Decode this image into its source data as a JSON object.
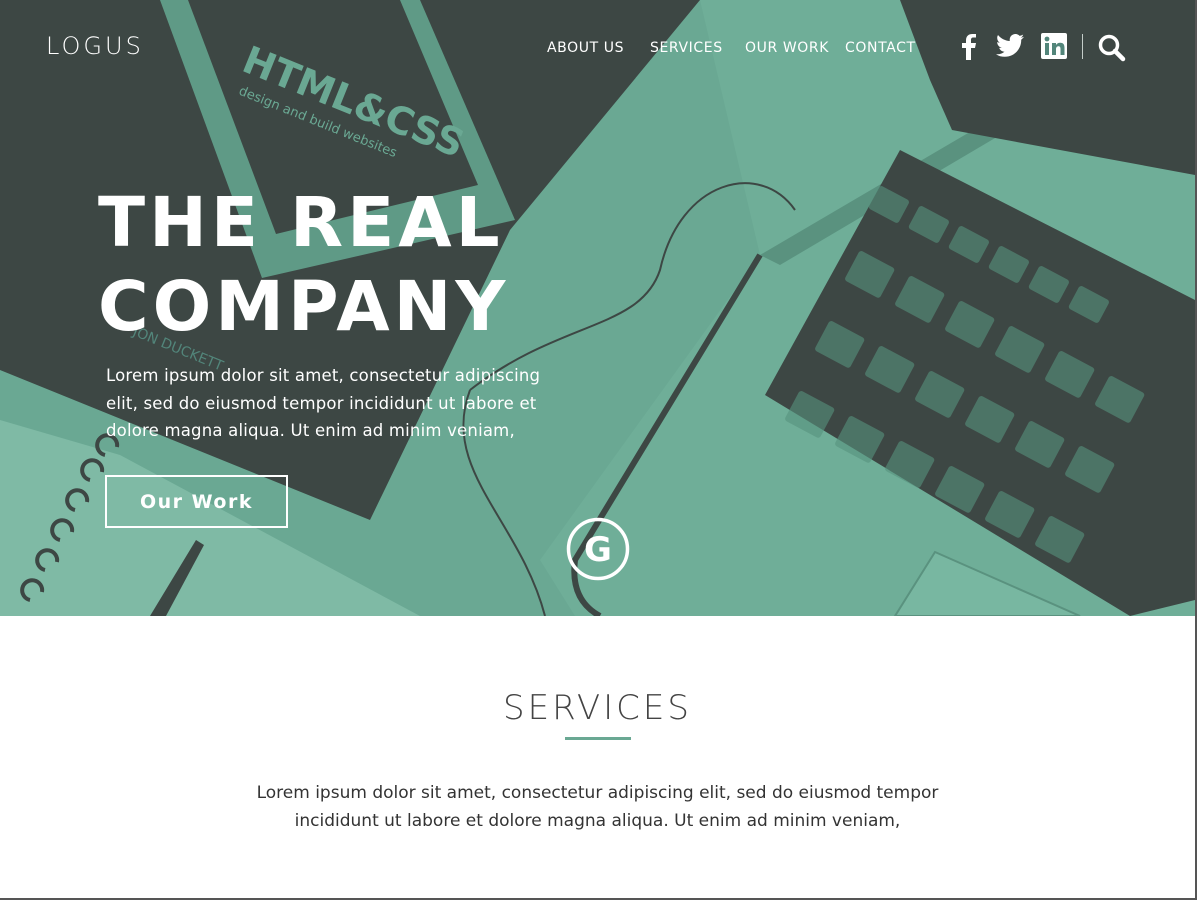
{
  "brand": {
    "logo_text": "LOGUS"
  },
  "nav": {
    "items": [
      {
        "label": "ABOUT US"
      },
      {
        "label": "SERVICES"
      },
      {
        "label": "OUR WORK"
      },
      {
        "label": "CONTACT"
      }
    ],
    "social": [
      "facebook-icon",
      "twitter-icon",
      "linkedin-icon"
    ],
    "search_icon": "search-icon"
  },
  "hero": {
    "headline_line1": "THE REAL",
    "headline_line2": "COMPANY",
    "text": "Lorem ipsum dolor sit amet, consectetur adipiscing elit, sed do eiusmod tempor incididunt ut labore et dolore magna aliqua. Ut enim ad minim veniam,",
    "cta_label": "Our Work",
    "book_title": "HTML&CSS",
    "book_subtitle": "design and build websites",
    "book_author": "JON DUCKETT",
    "badge_letter": "G"
  },
  "services": {
    "title": "SERVICES",
    "text": "Lorem ipsum dolor sit amet, consectetur adipiscing elit, sed do eiusmod tempor incididunt ut labore et dolore magna aliqua. Ut enim ad minim veniam,"
  },
  "colors": {
    "accent": "#6aa893",
    "hero_dark": "#3b4542",
    "text_dark": "#333333"
  }
}
